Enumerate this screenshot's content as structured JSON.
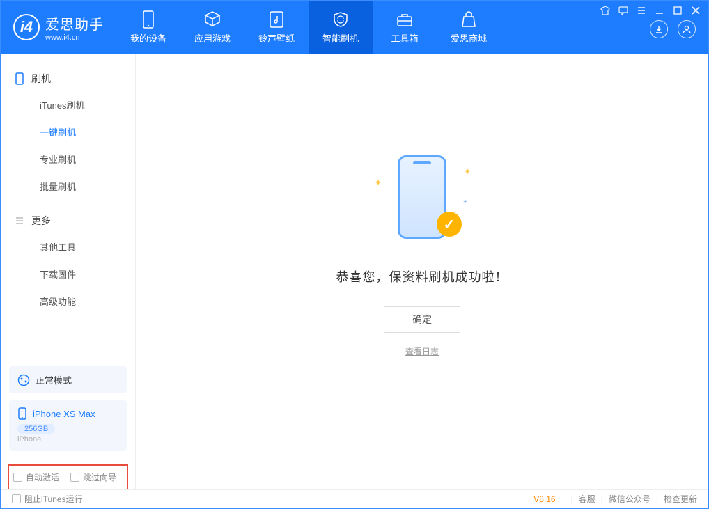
{
  "app": {
    "title": "爱思助手",
    "subtitle": "www.i4.cn"
  },
  "nav": {
    "items": [
      {
        "label": "我的设备"
      },
      {
        "label": "应用游戏"
      },
      {
        "label": "铃声壁纸"
      },
      {
        "label": "智能刷机"
      },
      {
        "label": "工具箱"
      },
      {
        "label": "爱思商城"
      }
    ]
  },
  "sidebar": {
    "section1": {
      "title": "刷机",
      "items": [
        "iTunes刷机",
        "一键刷机",
        "专业刷机",
        "批量刷机"
      ],
      "activeIndex": 1
    },
    "section2": {
      "title": "更多",
      "items": [
        "其他工具",
        "下载固件",
        "高级功能"
      ]
    },
    "mode_card": {
      "label": "正常模式"
    },
    "device_card": {
      "name": "iPhone XS Max",
      "storage": "256GB",
      "type": "iPhone"
    },
    "checkboxes": {
      "auto_activate": "自动激活",
      "skip_guide": "跳过向导"
    }
  },
  "main": {
    "success_message": "恭喜您，保资料刷机成功啦！",
    "ok_button": "确定",
    "view_log": "查看日志"
  },
  "footer": {
    "block_itunes": "阻止iTunes运行",
    "version": "V8.16",
    "links": [
      "客服",
      "微信公众号",
      "检查更新"
    ]
  }
}
